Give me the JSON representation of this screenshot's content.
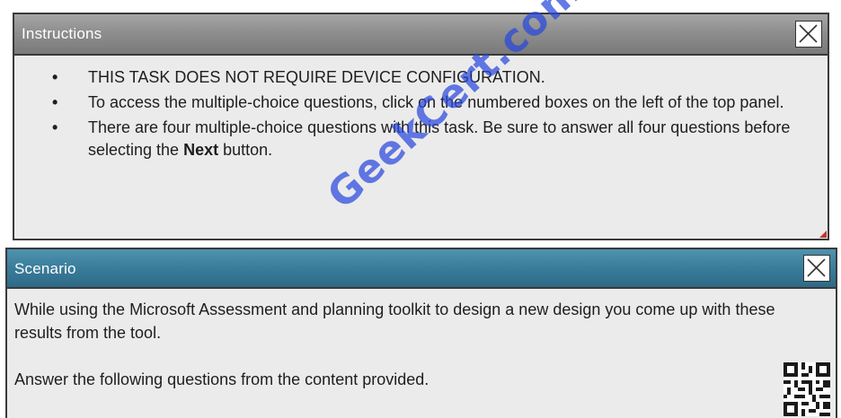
{
  "instructions": {
    "title": "Instructions",
    "items": [
      {
        "text": "THIS TASK DOES NOT REQUIRE DEVICE CONFIGURATION."
      },
      {
        "text": "To access the multiple-choice questions, click on the numbered boxes on the left of the top panel."
      },
      {
        "before": "There are four multiple-choice questions with this task. Be sure to answer all four questions before selecting the ",
        "bold": "Next",
        "after": " button."
      }
    ],
    "bullet": "•"
  },
  "scenario": {
    "title": "Scenario",
    "paragraphs": [
      "While using the Microsoft Assessment and planning toolkit to design a new design you come up with these results from the tool.",
      "Answer the following questions from the content provided."
    ]
  },
  "watermark": "GeekCert.com",
  "colors": {
    "instructions_titlebar": "#8e8e8e",
    "scenario_titlebar": "#3a7c9b",
    "panel_body": "#ebebeb",
    "watermark": "#2846dc"
  },
  "icons": {
    "close": "close-icon",
    "qr": "qr-code-icon"
  }
}
